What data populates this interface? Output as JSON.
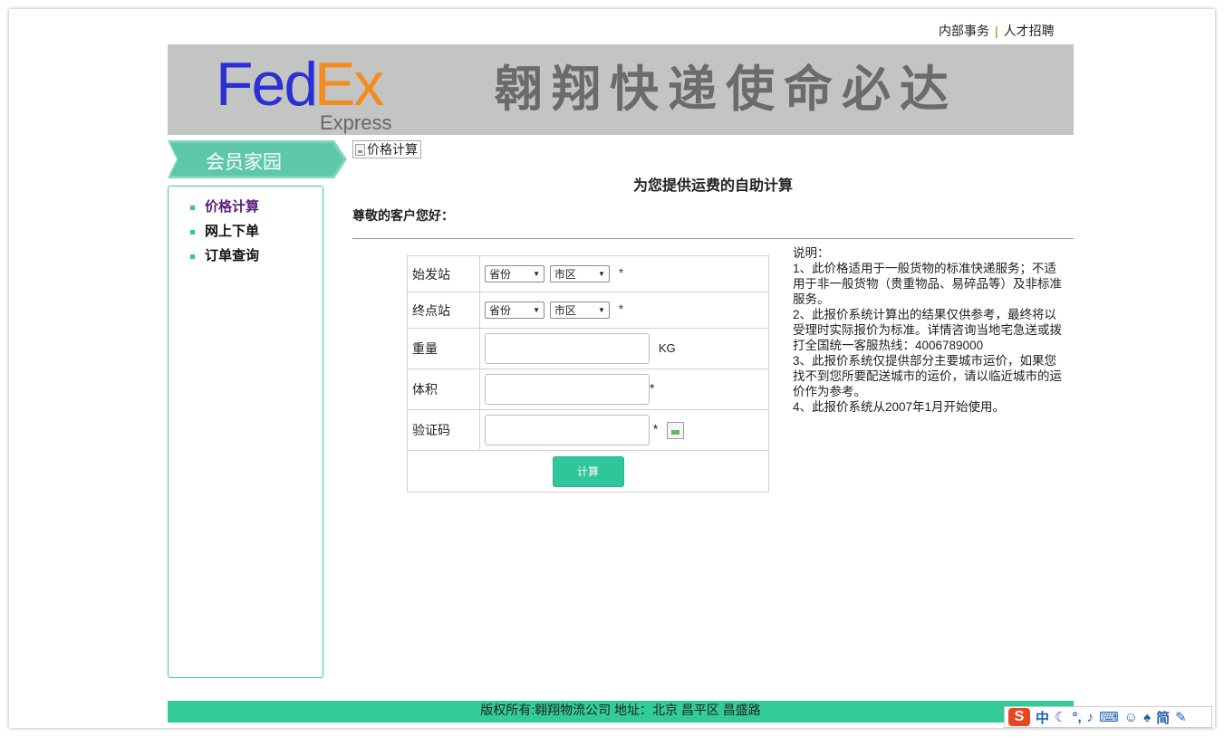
{
  "top_links": {
    "internal": "内部事务",
    "separator": "|",
    "careers": "人才招聘"
  },
  "banner": {
    "logo_fed": "Fed",
    "logo_ex": "Ex",
    "logo_sub": "Express",
    "slogan": "翱翔快递使命必达",
    "colors": {
      "fed": "#2d2fd6",
      "ex": "#f68a1f",
      "background": "#c3c5c3"
    }
  },
  "sidebar": {
    "title": "会员家园",
    "items": [
      {
        "label": "价格计算",
        "active": true
      },
      {
        "label": "网上下单",
        "active": false
      },
      {
        "label": "订单查询",
        "active": false
      }
    ],
    "accent": "#2fc69a"
  },
  "main": {
    "image_alt": "价格计算",
    "heading": "为您提供运费的自助计算",
    "greeting": "尊敬的客户您好："
  },
  "form": {
    "origin_label": "始发站",
    "destination_label": "终点站",
    "weight_label": "重量",
    "volume_label": "体积",
    "captcha_label": "验证码",
    "province_value": "省份",
    "city_value": "市区",
    "required_mark": "*",
    "weight_unit": "KG",
    "weight_value": "",
    "volume_value": "",
    "captcha_value": "",
    "submit_label": "计算"
  },
  "notes": {
    "title": "说明：",
    "items": [
      "1、此价格适用于一般货物的标准快递服务；不适用于非一般货物（贵重物品、易碎品等）及非标准服务。",
      "2、此报价系统计算出的结果仅供参考，最终将以受理时实际报价为标准。详情咨询当地宅急送或拨打全国统一客服热线：4006789000",
      "3、此报价系统仅提供部分主要城市运价，如果您找不到您所要配送城市的运价，请以临近城市的运价作为参考。",
      "4、此报价系统从2007年1月开始使用。"
    ]
  },
  "footer": {
    "text": "版权所有:翱翔物流公司 地址：北京 昌平区 昌盛路"
  },
  "ime": {
    "logo": "S",
    "lang": "中",
    "simplified": "简"
  }
}
